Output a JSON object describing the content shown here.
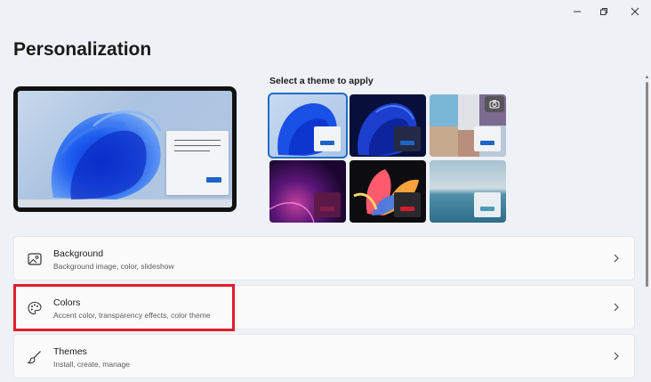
{
  "page": {
    "title": "Personalization"
  },
  "window_controls": [
    {
      "name": "minimize",
      "glyph": "—"
    },
    {
      "name": "restore",
      "glyph": "❐"
    },
    {
      "name": "close",
      "glyph": "✕"
    }
  ],
  "themes": {
    "heading": "Select a theme to apply",
    "selected_index": 0,
    "items": [
      {
        "name": "windows-light",
        "accent": "#1d64c8"
      },
      {
        "name": "windows-dark",
        "accent": "#1d64c8"
      },
      {
        "name": "windows-spotlight",
        "accent": "#1d64c8"
      },
      {
        "name": "glow",
        "accent": "#8a1f4d"
      },
      {
        "name": "captured-motion",
        "accent": "#d21c2c"
      },
      {
        "name": "flow",
        "accent": "#4a9ab8"
      }
    ]
  },
  "settings": [
    {
      "title": "Background",
      "subtitle": "Background image, color, slideshow",
      "icon": "image-icon"
    },
    {
      "title": "Colors",
      "subtitle": "Accent color, transparency effects, color theme",
      "icon": "palette-icon"
    },
    {
      "title": "Themes",
      "subtitle": "Install, create, manage",
      "icon": "brush-icon"
    }
  ],
  "colors": {
    "accent": "#1d64c8",
    "highlight": "#e21d2d"
  }
}
